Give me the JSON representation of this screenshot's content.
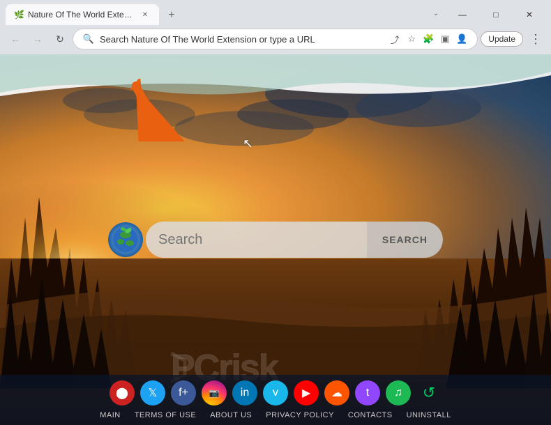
{
  "browser": {
    "tab": {
      "title": "Nature Of The World Extension",
      "favicon": "🌿"
    },
    "new_tab_label": "+",
    "window_controls": {
      "minimize": "—",
      "restore": "□",
      "close": "✕",
      "chevron": "⌄"
    },
    "nav": {
      "back": "←",
      "forward": "→",
      "refresh": "↻"
    },
    "address": {
      "text": "Search Nature Of The World Extension or type a URL",
      "share_icon": "⎋",
      "bookmark_icon": "☆",
      "extensions_icon": "🧩",
      "profile_icon": "👤",
      "sidebar_icon": "▣"
    },
    "update_btn": "Update",
    "menu_btn": "⋮"
  },
  "page": {
    "search": {
      "placeholder": "Search",
      "button_label": "SEARCH"
    },
    "footer": {
      "links": [
        {
          "label": "MAIN"
        },
        {
          "label": "TERMS OF USE"
        },
        {
          "label": "ABOUT US"
        },
        {
          "label": "PRIVACY POLICY"
        },
        {
          "label": "CONTACTS"
        },
        {
          "label": "UNINSTALL"
        }
      ],
      "social_icons": [
        {
          "name": "custom-app",
          "color": "#d03030",
          "symbol": "⬤"
        },
        {
          "name": "twitter",
          "color": "#1da1f2",
          "symbol": "𝕏"
        },
        {
          "name": "facebook-f",
          "color": "#3b5998",
          "symbol": "f"
        },
        {
          "name": "instagram",
          "color": "#c13584",
          "symbol": "📷"
        },
        {
          "name": "linkedin",
          "color": "#0077b5",
          "symbol": "in"
        },
        {
          "name": "vimeo",
          "color": "#1ab7ea",
          "symbol": "v"
        },
        {
          "name": "youtube",
          "color": "#ff0000",
          "symbol": "▶"
        },
        {
          "name": "soundcloud",
          "color": "#ff5500",
          "symbol": "☁"
        },
        {
          "name": "twitch",
          "color": "#9146ff",
          "symbol": "t"
        },
        {
          "name": "spotify",
          "color": "#1db954",
          "symbol": "♫"
        },
        {
          "name": "refresh-green",
          "color": "#00cc66",
          "symbol": "↺"
        }
      ]
    }
  }
}
